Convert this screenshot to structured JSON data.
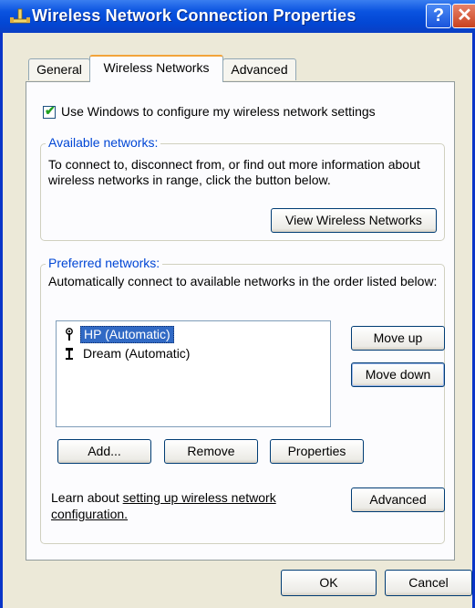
{
  "window": {
    "title": "Wireless Network Connection Properties",
    "help_label": "?",
    "close_label": "✕"
  },
  "tabs": [
    {
      "label": "General",
      "active": false
    },
    {
      "label": "Wireless Networks",
      "active": true
    },
    {
      "label": "Advanced",
      "active": false
    }
  ],
  "settings": {
    "use_windows_label": "Use Windows to configure my wireless network settings",
    "use_windows_checked": true
  },
  "available": {
    "legend": "Available networks:",
    "description": "To connect to, disconnect from, or find out more information about wireless networks in range, click the button below.",
    "view_button": "View Wireless Networks"
  },
  "preferred": {
    "legend": "Preferred networks:",
    "description": "Automatically connect to available networks in the order listed below:",
    "networks": [
      {
        "name": "HP (Automatic)",
        "selected": true
      },
      {
        "name": "Dream (Automatic)",
        "selected": false
      }
    ],
    "move_up": "Move up",
    "move_down": "Move down",
    "add": "Add...",
    "remove": "Remove",
    "properties": "Properties"
  },
  "learn": {
    "prefix": "Learn about ",
    "link_line1": "setting up wireless network",
    "link_line2": "configuration.",
    "advanced_button": "Advanced"
  },
  "footer": {
    "ok": "OK",
    "cancel": "Cancel"
  }
}
